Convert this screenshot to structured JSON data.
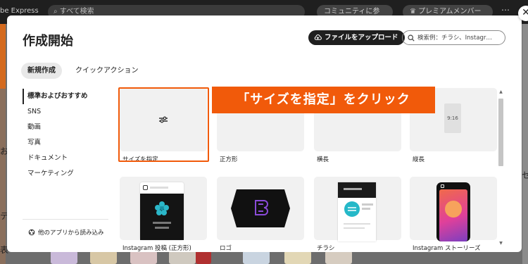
{
  "background": {
    "logo": "be Express",
    "search_placeholder": "すべて検索",
    "community_label": "コミュニティに参加",
    "premium_label": "プレミアムメンバー",
    "left_chars": [
      "ラ",
      "お",
      "テ",
      "表"
    ],
    "right_chars": [
      "セ",
      "・"
    ]
  },
  "modal": {
    "title": "作成開始",
    "upload_label": "ファイルをアップロード",
    "search_placeholder": "検索例：チラシ、Instagr…",
    "tabs": [
      {
        "label": "新規作成",
        "active": true
      },
      {
        "label": "クイックアクション",
        "active": false
      }
    ],
    "sidebar": [
      {
        "label": "標準およびおすすめ",
        "active": true
      },
      {
        "label": "SNS"
      },
      {
        "label": "動画"
      },
      {
        "label": "写真"
      },
      {
        "label": "ドキュメント"
      },
      {
        "label": "マーケティング"
      }
    ],
    "import_label": "他のアプリから読み込み",
    "cards_row1": [
      {
        "label": "サイズを指定",
        "icon": "sliders-icon"
      },
      {
        "label": "正方形"
      },
      {
        "label": "横長"
      },
      {
        "label": "縦長",
        "ratio": "9:16"
      }
    ],
    "cards_row2": [
      {
        "label": "Instagram 投稿 (正方形)"
      },
      {
        "label": "ロゴ"
      },
      {
        "label": "チラシ"
      },
      {
        "label": "Instagram ストーリーズ"
      }
    ],
    "callout": "「サイズを指定」をクリック"
  },
  "colors": {
    "accent_orange": "#f15a0a",
    "dark_button": "#1f1f1f",
    "thumb_bg": "#f1f1f1"
  }
}
